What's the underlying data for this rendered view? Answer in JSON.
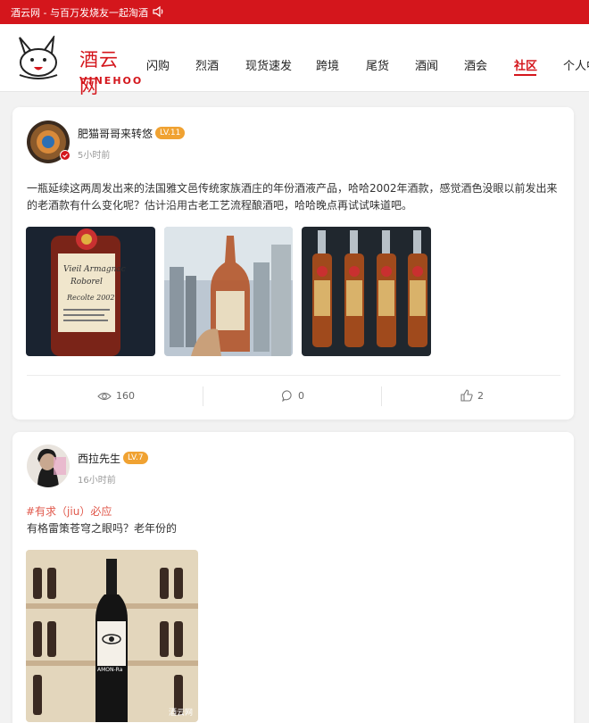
{
  "topbar": {
    "slogan": "酒云网 - 与百万发烧友一起淘酒",
    "sound_icon": "speaker-icon"
  },
  "logo": {
    "cn": "酒云网",
    "en": "VINEHOO"
  },
  "nav": {
    "items": [
      "闪购",
      "烈酒",
      "现货速发",
      "跨境",
      "尾货",
      "酒闻",
      "酒会",
      "社区",
      "个人中"
    ],
    "active": "社区"
  },
  "posts": [
    {
      "username": "肥猫哥哥来转悠",
      "level": "LV.11",
      "time": "5小时前",
      "text": " 一瓶延续这两周发出来的法国雅文邑传统家族酒庄的年份酒液产品，哈哈2002年酒款，感觉酒色没眼以前发出来的老酒款有什么变化呢？估计沿用古老工艺流程酿酒吧，哈哈晚点再试试味道吧。",
      "photos": [
        "armagnac-bottle-closeup",
        "bottle-held-city-view",
        "four-bottles"
      ],
      "views": "160",
      "comments": "0",
      "likes": "2"
    },
    {
      "username": "西拉先生",
      "level": "LV.7",
      "time": "16小时前",
      "tag": "#有求（jiu）必应",
      "text": " 有格雷策苍穹之眼吗？老年份的",
      "photos": [
        "amon-ra-bottle"
      ],
      "watermark": "酒云网"
    }
  ],
  "colors": {
    "brand": "#d4161c",
    "level_badge": "#f0a232",
    "tag": "#e0574a"
  }
}
